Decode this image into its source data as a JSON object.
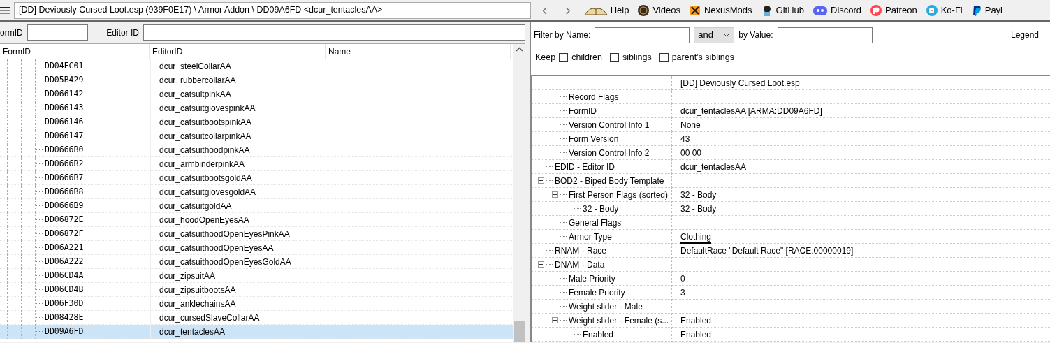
{
  "toolbar": {
    "path": "[DD] Deviously Cursed Loot.esp (939F0E17) \\ Armor Addon \\ DD09A6FD <dcur_tentaclesAA>",
    "back": "‹",
    "forward": "›",
    "links": [
      {
        "label": "Help"
      },
      {
        "label": "Videos"
      },
      {
        "label": "NexusMods"
      },
      {
        "label": "GitHub"
      },
      {
        "label": "Discord"
      },
      {
        "label": "Patreon"
      },
      {
        "label": "Ko-Fi"
      },
      {
        "label": "Payl"
      }
    ]
  },
  "left": {
    "formid_label": "ormID",
    "editorid_label": "Editor ID",
    "columns": [
      "FormID",
      "EditorID",
      "Name"
    ],
    "rows": [
      {
        "formid": "DD04EC01",
        "editorid": "dcur_steelCollarAA",
        "selected": false
      },
      {
        "formid": "DD05B429",
        "editorid": "dcur_rubbercollarAA",
        "selected": false
      },
      {
        "formid": "DD066142",
        "editorid": "dcur_catsuitpinkAA",
        "selected": false
      },
      {
        "formid": "DD066143",
        "editorid": "dcur_catsuitglovespinkAA",
        "selected": false
      },
      {
        "formid": "DD066146",
        "editorid": "dcur_catsuitbootspinkAA",
        "selected": false
      },
      {
        "formid": "DD066147",
        "editorid": "dcur_catsuitcollarpinkAA",
        "selected": false
      },
      {
        "formid": "DD0666B0",
        "editorid": "dcur_catsuithoodpinkAA",
        "selected": false
      },
      {
        "formid": "DD0666B2",
        "editorid": "dcur_armbinderpinkAA",
        "selected": false
      },
      {
        "formid": "DD0666B7",
        "editorid": "dcur_catsuitbootsgoldAA",
        "selected": false
      },
      {
        "formid": "DD0666B8",
        "editorid": "dcur_catsuitglovesgoldAA",
        "selected": false
      },
      {
        "formid": "DD0666B9",
        "editorid": "dcur_catsuitgoldAA",
        "selected": false
      },
      {
        "formid": "DD06872E",
        "editorid": "dcur_hoodOpenEyesAA",
        "selected": false
      },
      {
        "formid": "DD06872F",
        "editorid": "dcur_catsuithoodOpenEyesPinkAA",
        "selected": false
      },
      {
        "formid": "DD06A221",
        "editorid": "dcur_catsuithoodOpenEyesAA",
        "selected": false
      },
      {
        "formid": "DD06A222",
        "editorid": "dcur_catsuithoodOpenEyesGoldAA",
        "selected": false
      },
      {
        "formid": "DD06CD4A",
        "editorid": "dcur_zipsuitAA",
        "selected": false
      },
      {
        "formid": "DD06CD4B",
        "editorid": "dcur_zipsuitbootsAA",
        "selected": false
      },
      {
        "formid": "DD06F30D",
        "editorid": "dcur_anklechainsAA",
        "selected": false
      },
      {
        "formid": "DD08428E",
        "editorid": "dcur_cursedSlaveCollarAA",
        "selected": false
      },
      {
        "formid": "DD09A6FD",
        "editorid": "dcur_tentaclesAA",
        "selected": true
      }
    ]
  },
  "right": {
    "filter_name_label": "Filter by Name:",
    "operator": "and",
    "by_value_label": "by Value:",
    "legend": "Legend",
    "keep_label": "Keep",
    "keep_options": [
      {
        "label": "children",
        "checked": false
      },
      {
        "label": "siblings",
        "checked": false
      },
      {
        "label": "parent's siblings",
        "checked": false
      }
    ],
    "file_header": "[DD] Deviously Cursed Loot.esp",
    "tree": [
      {
        "children": [
          {
            "label": "Record Flags"
          },
          {
            "label": "FormID",
            "value": "dcur_tentaclesAA [ARMA:DD09A6FD]"
          },
          {
            "label": "Version Control Info 1",
            "value": "None"
          },
          {
            "label": "Form Version",
            "value": "43"
          },
          {
            "label": "Version Control Info 2",
            "value": "00 00"
          }
        ]
      },
      {
        "label": "EDID - Editor ID",
        "value": "dcur_tentaclesAA"
      },
      {
        "label": "BOD2 - Biped Body Template",
        "expanded": true,
        "children": [
          {
            "label": "First Person Flags (sorted)",
            "value": "32 - Body",
            "expanded": true,
            "children": [
              {
                "label": "32 - Body",
                "value": "32 - Body"
              }
            ]
          },
          {
            "label": "General Flags"
          },
          {
            "label": "Armor Type",
            "value": "Clothing",
            "highlighted": true
          }
        ]
      },
      {
        "label": "RNAM - Race",
        "value": "DefaultRace \"Default Race\" [RACE:00000019]"
      },
      {
        "label": "DNAM - Data",
        "expanded": true,
        "children": [
          {
            "label": "Male Priority",
            "value": "0"
          },
          {
            "label": "Female Priority",
            "value": "3"
          },
          {
            "label": "Weight slider - Male"
          },
          {
            "label": "Weight slider - Female (s...",
            "value": "Enabled",
            "expanded": true,
            "children": [
              {
                "label": "Enabled",
                "value": "Enabled"
              }
            ]
          }
        ]
      }
    ]
  }
}
